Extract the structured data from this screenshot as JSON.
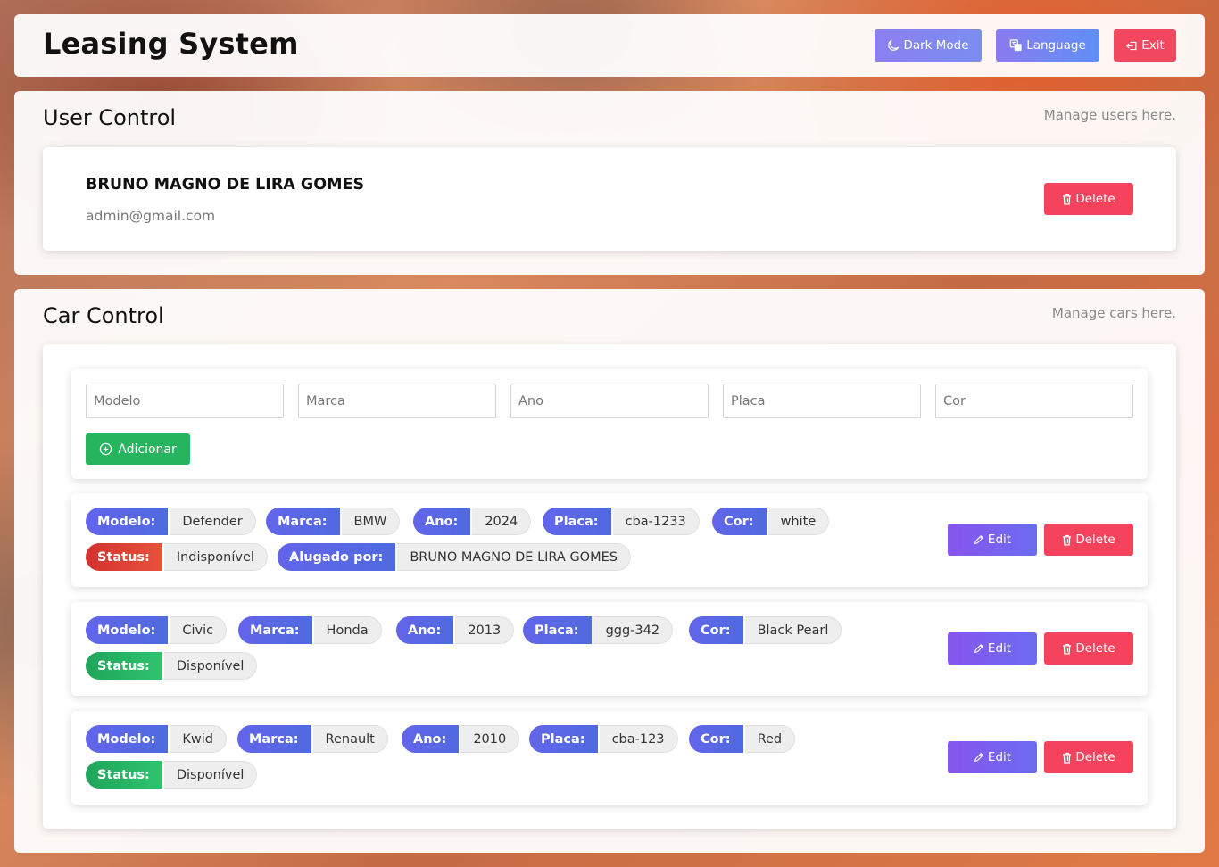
{
  "header": {
    "title": "Leasing System",
    "dark_mode_label": "Dark Mode",
    "language_label": "Language",
    "exit_label": "Exit"
  },
  "user_control": {
    "title": "User Control",
    "subtitle": "Manage users here.",
    "users": [
      {
        "name": "BRUNO MAGNO DE LIRA GOMES",
        "email": "admin@gmail.com",
        "delete_label": "Delete"
      }
    ]
  },
  "car_control": {
    "title": "Car Control",
    "subtitle": "Manage cars here.",
    "form": {
      "modelo_placeholder": "Modelo",
      "marca_placeholder": "Marca",
      "ano_placeholder": "Ano",
      "placa_placeholder": "Placa",
      "cor_placeholder": "Cor",
      "add_label": "Adicionar"
    },
    "labels": {
      "modelo": "Modelo:",
      "marca": "Marca:",
      "ano": "Ano:",
      "placa": "Placa:",
      "cor": "Cor:",
      "status": "Status:",
      "alugado_por": "Alugado por:",
      "edit": "Edit",
      "delete": "Delete"
    },
    "cars": [
      {
        "modelo": "Defender",
        "marca": "BMW",
        "ano": "2024",
        "placa": "cba-1233",
        "cor": "white",
        "status": "Indisponível",
        "alugado_por": "BRUNO MAGNO DE LIRA GOMES"
      },
      {
        "modelo": "Civic",
        "marca": "Honda",
        "ano": "2013",
        "placa": "ggg-342",
        "cor": "Black Pearl",
        "status": "Disponível"
      },
      {
        "modelo": "Kwid",
        "marca": "Renault",
        "ano": "2010",
        "placa": "cba-123",
        "cor": "Red",
        "status": "Disponível"
      }
    ]
  },
  "colors": {
    "tag_key": "#5a67e6",
    "status_unavailable": "#d9392f",
    "status_available": "#23b262",
    "delete": "#f5435d",
    "edit": "#7b5ff0",
    "add": "#27b45f"
  },
  "icons": {
    "dark_mode": "moon-icon",
    "language": "translate-icon",
    "exit": "exit-icon",
    "delete": "trash-icon",
    "edit": "pencil-icon",
    "add": "plus-circle-icon"
  }
}
